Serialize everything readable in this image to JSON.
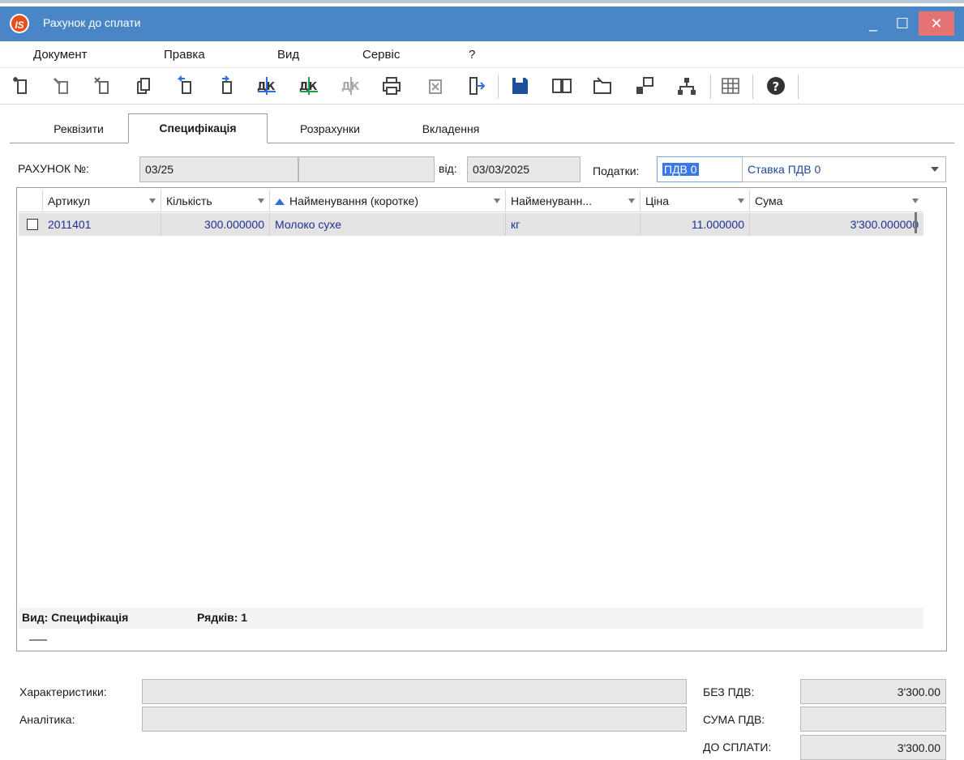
{
  "window": {
    "title": "Рахунок до сплати",
    "app_icon_text": "IS",
    "controls": {
      "minimize": "_",
      "maximize": "☐",
      "close": "✕"
    }
  },
  "menu": [
    "Документ",
    "Правка",
    "Вид",
    "Сервіс",
    "?"
  ],
  "toolbar": {
    "icons": [
      "new-doc-icon",
      "edit-doc-icon",
      "delete-doc-icon",
      "copy-doc-icon",
      "doc-back-icon",
      "doc-forward-icon",
      "debit-credit-icon",
      "debit-credit-green-icon",
      "debit-credit-gray-icon",
      "print-icon",
      "disabled-x-icon",
      "exit-icon",
      "save-icon",
      "book-icon",
      "folder-icon",
      "link-icon",
      "hierarchy-icon",
      "table-icon",
      "help-icon"
    ]
  },
  "tabs": [
    "Реквізити",
    "Специфікація",
    "Розрахунки",
    "Вкладення"
  ],
  "active_tab": "Специфікація",
  "header": {
    "invoice_label": "РАХУНОК №:",
    "invoice_number": "03/25",
    "invoice_extra": "",
    "date_label": "від:",
    "date_value": "03/03/2025",
    "taxes_label": "Податки:",
    "taxes_code": "ПДВ 0",
    "vat_rate": "Ставка ПДВ 0"
  },
  "grid": {
    "columns": [
      "Артикул",
      "Кількість",
      "Найменування (коротке)",
      "Найменуванн...",
      "Ціна",
      "Сума"
    ],
    "rows": [
      {
        "article": "2011401",
        "quantity": "300.000000",
        "name_short": "Молоко сухе",
        "unit": "кг",
        "price": "11.000000",
        "sum": "3'300.000000"
      }
    ],
    "footer": {
      "view_label": "Вид: Специфікація",
      "rows_label": "Рядків: 1"
    }
  },
  "bottom": {
    "characteristics_label": "Характеристики:",
    "characteristics_value": "",
    "analytics_label": "Аналітика:",
    "analytics_value": "",
    "without_vat_label": "БЕЗ ПДВ:",
    "without_vat_value": "3'300.00",
    "vat_sum_label": "СУМА ПДВ:",
    "vat_sum_value": "",
    "to_pay_label": "ДО СПЛАТИ:",
    "to_pay_value": "3'300.00"
  }
}
